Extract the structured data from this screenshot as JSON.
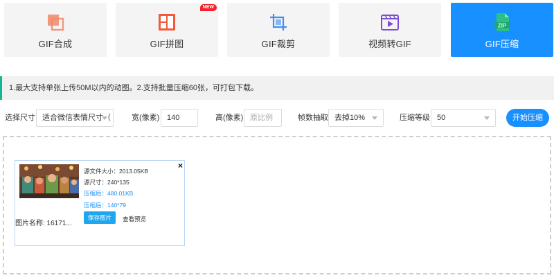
{
  "tools": [
    {
      "label": "GIF合成",
      "icon": "gif-merge-icon",
      "active": false
    },
    {
      "label": "GIF拼图",
      "icon": "gif-collage-icon",
      "badge": "NEW",
      "active": false
    },
    {
      "label": "GIF裁剪",
      "icon": "gif-crop-icon",
      "active": false
    },
    {
      "label": "视频转GIF",
      "icon": "video-to-gif-icon",
      "active": false
    },
    {
      "label": "GIF压缩",
      "icon": "zip-icon",
      "icon_text": "ZIP",
      "active": true
    }
  ],
  "colors": {
    "accent": "#1890ff",
    "notice_border": "#13b592",
    "merge_icon": "#f08868",
    "collage_icon": "#f35a3a",
    "crop_icon": "#3f8ef5",
    "video_icon": "#7c4dd6",
    "zip_icon": "#2bc183"
  },
  "notice": "1.最大支持单张上传50M以内的动图。2.支持批量压缩60张，可打包下载。",
  "settings": {
    "size_label": "选择尺寸",
    "size_value": "适合微信表情尺寸（",
    "width_label": "宽(像素)",
    "width_value": "140",
    "height_label": "高(像素)",
    "height_placeholder": "原比例",
    "frame_label": "帧数抽取",
    "frame_value": "去掉10%",
    "level_label": "压缩等级",
    "level_value": "50",
    "start_button": "开始压缩"
  },
  "card": {
    "filename": "图片名称:  16171...",
    "source_size": "源文件大小：2013.05KB",
    "source_dims": "源尺寸：240*135",
    "compressed_size": "压缩后：480.01KB",
    "compressed_dims": "压缩后：140*79",
    "save_button": "保存图片",
    "preview_link": "查看预览",
    "close": "×"
  }
}
